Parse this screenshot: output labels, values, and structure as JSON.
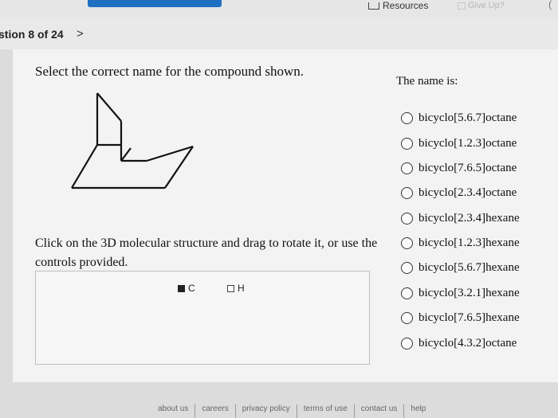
{
  "header": {
    "resources_label": "Resources",
    "give_up_label": "Give Up?",
    "edge_glyph": "("
  },
  "question_nav": {
    "counter": "stion 8 of 24",
    "next_glyph": ">"
  },
  "question": {
    "prompt": "Select the correct name for the compound shown.",
    "name_heading": "The name is:",
    "options": [
      "bicyclo[5.6.7]octane",
      "bicyclo[1.2.3]octane",
      "bicyclo[7.6.5]octane",
      "bicyclo[2.3.4]octane",
      "bicyclo[2.3.4]hexane",
      "bicyclo[1.2.3]hexane",
      "bicyclo[5.6.7]hexane",
      "bicyclo[3.2.1]hexane",
      "bicyclo[7.6.5]hexane",
      "bicyclo[4.3.2]octane"
    ]
  },
  "viewer": {
    "instructions": "Click on the 3D molecular structure and drag to rotate it, or use the controls provided.",
    "carbon_label": "C",
    "hydrogen_label": "H",
    "carbon_checked": true,
    "hydrogen_checked": false
  },
  "footer": {
    "links": [
      "about us",
      "careers",
      "privacy policy",
      "terms of use",
      "contact us",
      "help"
    ]
  }
}
